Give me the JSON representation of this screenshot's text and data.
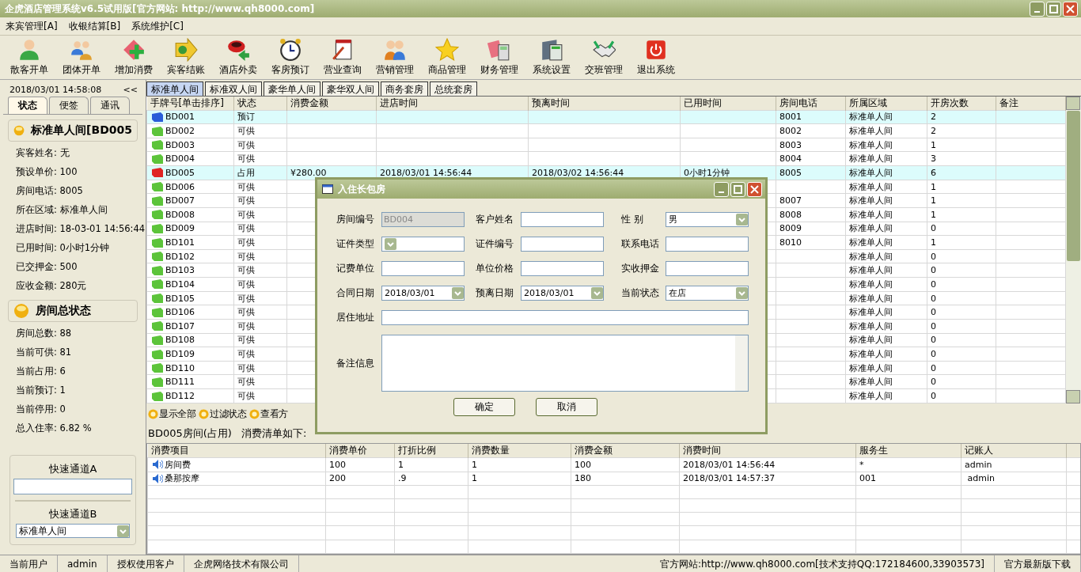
{
  "window": {
    "title": "企虎酒店管理系统v6.5试用版[官方网站: http://www.qh8000.com]"
  },
  "menu": [
    "来宾管理[A]",
    "收银结算[B]",
    "系统维护[C]"
  ],
  "toolbar": [
    "散客开单",
    "团体开单",
    "增加消费",
    "宾客结账",
    "酒店外卖",
    "客房预订",
    "营业查询",
    "营销管理",
    "商品管理",
    "财务管理",
    "系统设置",
    "交班管理",
    "退出系统"
  ],
  "side_panel": {
    "datetime": "2018/03/01 14:58:08",
    "collapse": "<<",
    "tabs": [
      {
        "label": "状态",
        "selected": true
      },
      {
        "label": "便签",
        "selected": false
      },
      {
        "label": "通讯",
        "selected": false
      }
    ],
    "room_header": "标准单人间[BD005",
    "room_info": [
      {
        "label": "宾客姓名:",
        "value": "无"
      },
      {
        "label": "预设单价:",
        "value": "100"
      },
      {
        "label": "房间电话:",
        "value": "8005"
      },
      {
        "label": "所在区域:",
        "value": "标准单人间"
      },
      {
        "label": "进店时间:",
        "value": "18-03-01 14:56:44"
      },
      {
        "label": "已用时间:",
        "value": "0小时1分钟"
      },
      {
        "label": "已交押金:",
        "value": "500"
      },
      {
        "label": "应收金额:",
        "value": "280元"
      }
    ],
    "summary_header": "房间总状态",
    "summary": [
      {
        "label": "房间总数:",
        "value": "88"
      },
      {
        "label": "当前可供:",
        "value": "81"
      },
      {
        "label": "当前占用:",
        "value": "6"
      },
      {
        "label": "当前预订:",
        "value": "1"
      },
      {
        "label": "当前停用:",
        "value": "0"
      },
      {
        "label": "总入住率:",
        "value": "6.82 %"
      }
    ],
    "quick_a": {
      "label": "快速通道A"
    },
    "quick_b": {
      "label": "快速通道B",
      "value": "标准单人间"
    }
  },
  "room_tabs": [
    {
      "label": "标准单人间",
      "selected": true
    },
    {
      "label": "标准双人间",
      "selected": false
    },
    {
      "label": "豪华单人间",
      "selected": false
    },
    {
      "label": "豪华双人间",
      "selected": false
    },
    {
      "label": "商务套房",
      "selected": false
    },
    {
      "label": "总统套房",
      "selected": false
    }
  ],
  "rooms": {
    "columns": [
      "手牌号[单击排序]",
      "状态",
      "消费金额",
      "进店时间",
      "预离时间",
      "已用时间",
      "房间电话",
      "所属区域",
      "开房次数",
      "备注"
    ],
    "rows": [
      {
        "color": "#2a5cd8",
        "highlighted": true,
        "tag": "BD001",
        "status": "预订",
        "phone": "8001",
        "area": "标准单人间",
        "count": "2"
      },
      {
        "color": "#5cc43a",
        "highlighted": false,
        "tag": "BD002",
        "status": "可供",
        "phone": "8002",
        "area": "标准单人间",
        "count": "2"
      },
      {
        "color": "#5cc43a",
        "highlighted": false,
        "tag": "BD003",
        "status": "可供",
        "phone": "8003",
        "area": "标准单人间",
        "count": "1"
      },
      {
        "color": "#5cc43a",
        "highlighted": false,
        "tag": "BD004",
        "status": "可供",
        "phone": "8004",
        "area": "标准单人间",
        "count": "3"
      },
      {
        "color": "#e02424",
        "highlighted": true,
        "tag": "BD005",
        "status": "占用",
        "amount": "¥280.00",
        "checkin": "2018/03/01 14:56:44",
        "checkout": "2018/03/02 14:56:44",
        "used": "0小时1分钟",
        "phone": "8005",
        "area": "标准单人间",
        "count": "6"
      },
      {
        "color": "#5cc43a",
        "highlighted": false,
        "tag": "BD006",
        "status": "可供",
        "area": "标准单人间",
        "count": "1"
      },
      {
        "color": "#5cc43a",
        "highlighted": false,
        "tag": "BD007",
        "status": "可供",
        "phone": "8007",
        "area": "标准单人间",
        "count": "1"
      },
      {
        "color": "#5cc43a",
        "highlighted": false,
        "tag": "BD008",
        "status": "可供",
        "phone": "8008",
        "area": "标准单人间",
        "count": "1"
      },
      {
        "color": "#5cc43a",
        "highlighted": false,
        "tag": "BD009",
        "status": "可供",
        "phone": "8009",
        "area": "标准单人间",
        "count": "0"
      },
      {
        "color": "#5cc43a",
        "highlighted": false,
        "tag": "BD101",
        "status": "可供",
        "phone": "8010",
        "area": "标准单人间",
        "count": "1"
      },
      {
        "color": "#5cc43a",
        "highlighted": false,
        "tag": "BD102",
        "status": "可供",
        "area": "标准单人间",
        "count": "0"
      },
      {
        "color": "#5cc43a",
        "highlighted": false,
        "tag": "BD103",
        "status": "可供",
        "area": "标准单人间",
        "count": "0"
      },
      {
        "color": "#5cc43a",
        "highlighted": false,
        "tag": "BD104",
        "status": "可供",
        "area": "标准单人间",
        "count": "0"
      },
      {
        "color": "#5cc43a",
        "highlighted": false,
        "tag": "BD105",
        "status": "可供",
        "area": "标准单人间",
        "count": "0"
      },
      {
        "color": "#5cc43a",
        "highlighted": false,
        "tag": "BD106",
        "status": "可供",
        "area": "标准单人间",
        "count": "0"
      },
      {
        "color": "#5cc43a",
        "highlighted": false,
        "tag": "BD107",
        "status": "可供",
        "area": "标准单人间",
        "count": "0"
      },
      {
        "color": "#5cc43a",
        "highlighted": false,
        "tag": "BD108",
        "status": "可供",
        "area": "标准单人间",
        "count": "0"
      },
      {
        "color": "#5cc43a",
        "highlighted": false,
        "tag": "BD109",
        "status": "可供",
        "area": "标准单人间",
        "count": "0"
      },
      {
        "color": "#5cc43a",
        "highlighted": false,
        "tag": "BD110",
        "status": "可供",
        "area": "标准单人间",
        "count": "0"
      },
      {
        "color": "#5cc43a",
        "highlighted": false,
        "tag": "BD111",
        "status": "可供",
        "area": "标准单人间",
        "count": "0"
      },
      {
        "color": "#5cc43a",
        "highlighted": false,
        "tag": "BD112",
        "status": "可供",
        "area": "标准单人间",
        "count": "0"
      }
    ]
  },
  "filter_bar": [
    "显示全部",
    "过滤状态",
    "查看方"
  ],
  "note": {
    "room": "BD005房间(占用)",
    "text": "消费清单如下:"
  },
  "charges": {
    "columns": [
      "消费项目",
      "消费单价",
      "打折比例",
      "消费数量",
      "消费金额",
      "消费时间",
      "服务生",
      "记账人"
    ],
    "rows": [
      [
        "房间费",
        "100",
        "1",
        "1",
        "100",
        "2018/03/01 14:56:44",
        "*",
        "admin"
      ],
      [
        "桑那按摩",
        "200",
        ".9",
        "1",
        "180",
        "2018/03/01 14:57:37",
        "001",
        " admin"
      ]
    ]
  },
  "status_bar": [
    "当前用户",
    "admin",
    "授权使用客户",
    "企虎网络技术有限公司",
    "官方网站:http://www.qh8000.com[技术支持QQ:172184600,33903573]",
    "官方最新版下载"
  ],
  "dialog": {
    "title": "入住长包房",
    "fields": [
      {
        "label": "房间编号",
        "kind": "text",
        "value": "BD004",
        "disabled": true
      },
      {
        "label": "客户姓名",
        "kind": "text",
        "disabled": false
      },
      {
        "label": "性 别",
        "kind": "select",
        "value": "男"
      },
      {
        "label": "证件类型",
        "kind": "select"
      },
      {
        "label": "证件编号",
        "kind": "text",
        "disabled": false
      },
      {
        "label": "联系电话",
        "kind": "text",
        "disabled": false
      },
      {
        "label": "记费单位",
        "kind": "text",
        "disabled": false
      },
      {
        "label": "单位价格",
        "kind": "text",
        "disabled": false
      },
      {
        "label": "实收押金",
        "kind": "text",
        "disabled": false
      },
      {
        "label": "合同日期",
        "kind": "select",
        "value": "2018/03/01"
      },
      {
        "label": "预离日期",
        "kind": "select",
        "value": "2018/03/01"
      },
      {
        "label": "当前状态",
        "kind": "select",
        "value": "在店"
      },
      {
        "label": "居住地址",
        "kind": "wide",
        "disabled": false
      },
      {
        "label": "备注信息",
        "kind": "memo"
      }
    ],
    "buttons": [
      "确定",
      "取消"
    ]
  }
}
